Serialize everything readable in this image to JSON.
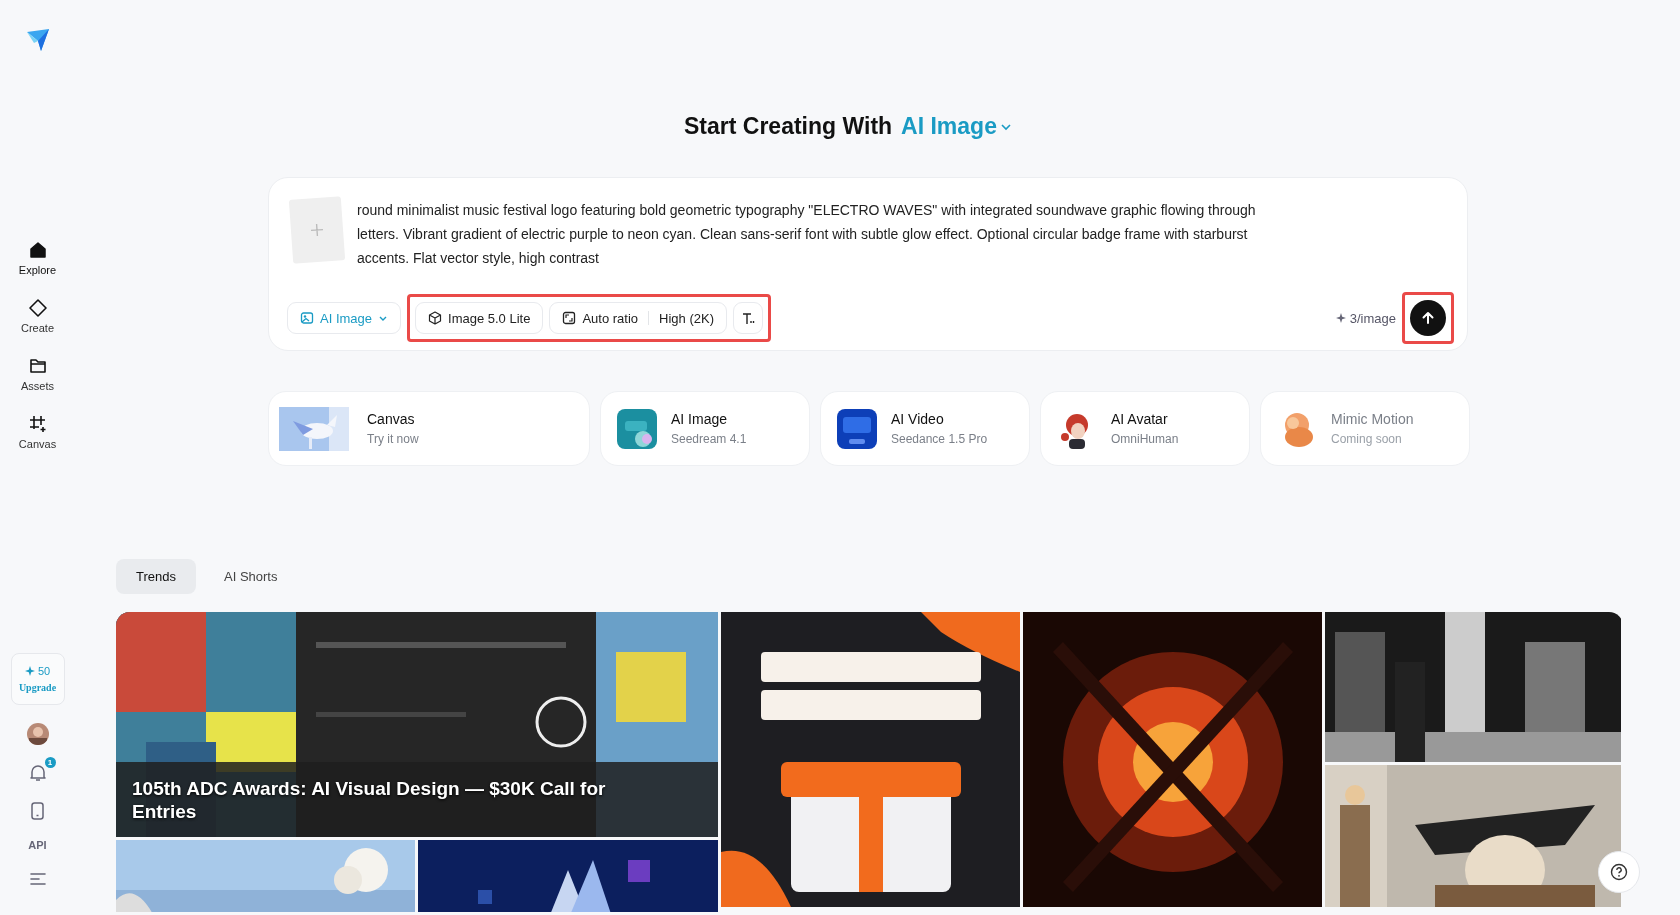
{
  "sidebar": {
    "nav": [
      {
        "label": "Explore",
        "selected": true
      },
      {
        "label": "Create",
        "selected": false
      },
      {
        "label": "Assets",
        "selected": false
      },
      {
        "label": "Canvas",
        "selected": false
      }
    ],
    "credits": "50",
    "upgrade": "Upgrade",
    "notifications": "1",
    "api": "API"
  },
  "heading": {
    "prefix": "Start Creating With",
    "mode": "AI Image"
  },
  "prompt": {
    "value": "round minimalist music festival logo featuring bold geometric typography \"ELECTRO WAVES\" with integrated soundwave graphic flowing through letters. Vibrant gradient of electric purple to neon cyan. Clean sans-serif font with subtle glow effect. Optional circular badge frame with starburst accents. Flat vector style, high contrast",
    "mode": "AI Image",
    "model": "Image 5.0 Lite",
    "ratio": "Auto ratio",
    "quality": "High (2K)",
    "cost": "3/image",
    "options_highlighted": true,
    "send_highlighted": true
  },
  "cards": [
    {
      "title": "Canvas",
      "subtitle": "Try it now",
      "disabled": false
    },
    {
      "title": "AI Image",
      "subtitle": "Seedream 4.1",
      "disabled": false
    },
    {
      "title": "AI Video",
      "subtitle": "Seedance 1.5 Pro",
      "disabled": false
    },
    {
      "title": "AI Avatar",
      "subtitle": "OmniHuman",
      "disabled": false
    },
    {
      "title": "Mimic Motion",
      "subtitle": "Coming soon",
      "disabled": true
    }
  ],
  "tabs": [
    {
      "label": "Trends",
      "selected": true
    },
    {
      "label": "AI Shorts",
      "selected": false
    }
  ],
  "gallery": {
    "caption": "105th ADC Awards: AI Visual Design — $30K Call for Entries"
  }
}
